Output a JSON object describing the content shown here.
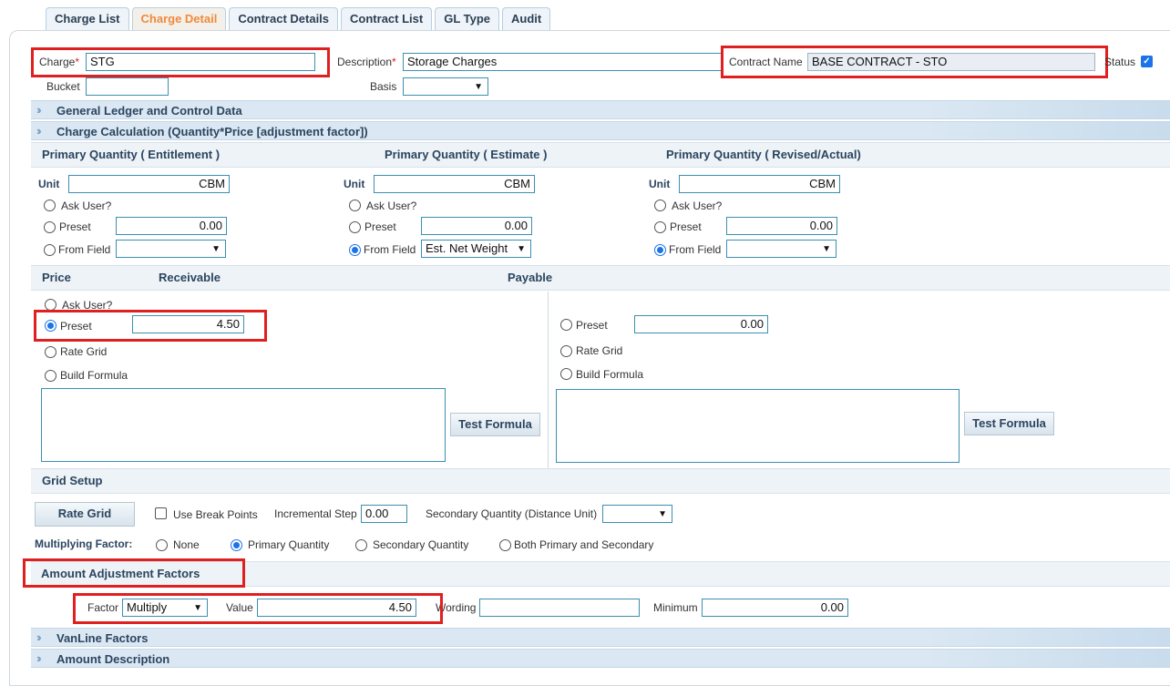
{
  "tabs": [
    "Charge List",
    "Charge Detail",
    "Contract Details",
    "Contract List",
    "GL Type",
    "Audit"
  ],
  "header": {
    "charge_label": "Charge",
    "charge_value": "STG",
    "description_label": "Description",
    "description_value": "Storage Charges",
    "contract_name_label": "Contract Name",
    "contract_name_value": "BASE CONTRACT - STO",
    "status_label": "Status",
    "bucket_label": "Bucket",
    "bucket_value": "",
    "basis_label": "Basis",
    "basis_value": "",
    "required_mark": "*"
  },
  "sections": {
    "gl": "General Ledger and Control Data",
    "calc": "Charge Calculation (Quantity*Price [adjustment factor])",
    "vanline": "VanLine Factors",
    "amount_desc": "Amount Description"
  },
  "quantities": [
    {
      "title": "Primary Quantity  ( Entitlement )",
      "unit_label": "Unit",
      "unit": "CBM",
      "ask": "Ask User?",
      "preset": "Preset",
      "preset_value": "0.00",
      "from_field": "From Field",
      "from_field_value": "",
      "selected": "none"
    },
    {
      "title": "Primary Quantity  ( Estimate )",
      "unit_label": "Unit",
      "unit": "CBM",
      "ask": "Ask User?",
      "preset": "Preset",
      "preset_value": "0.00",
      "from_field": "From Field",
      "from_field_value": "Est. Net Weight",
      "selected": "from_field"
    },
    {
      "title": "Primary Quantity  ( Revised/Actual)",
      "unit_label": "Unit",
      "unit": "CBM",
      "ask": "Ask User?",
      "preset": "Preset",
      "preset_value": "0.00",
      "from_field": "From Field",
      "from_field_value": "",
      "selected": "from_field"
    }
  ],
  "price": {
    "price_label": "Price",
    "receivable_label": "Receivable",
    "payable_label": "Payable",
    "receivable": {
      "ask": "Ask User?",
      "preset": "Preset",
      "preset_value": "4.50",
      "rate_grid": "Rate Grid",
      "build_formula": "Build Formula",
      "test_formula": "Test Formula",
      "selected": "preset"
    },
    "payable": {
      "preset": "Preset",
      "preset_value": "0.00",
      "rate_grid": "Rate Grid",
      "build_formula": "Build Formula",
      "test_formula": "Test Formula",
      "selected": "none"
    }
  },
  "grid_setup": {
    "title": "Grid Setup",
    "rate_grid_button": "Rate Grid",
    "use_break_points": "Use Break Points",
    "incremental_step_label": "Incremental Step",
    "incremental_step_value": "0.00",
    "secondary_quantity_label": "Secondary Quantity (Distance Unit)",
    "secondary_quantity_value": "",
    "multiplying_factor_label": "Multiplying Factor:",
    "options": [
      "None",
      "Primary Quantity",
      "Secondary Quantity",
      "Both Primary and Secondary"
    ],
    "selected_option": "Primary Quantity"
  },
  "adjustment": {
    "title": "Amount Adjustment Factors",
    "factor_label": "Factor",
    "factor_value": "Multiply",
    "value_label": "Value",
    "value": "4.50",
    "wording_label": "Wording",
    "wording_value": "",
    "minimum_label": "Minimum",
    "minimum_value": "0.00"
  },
  "colors": {
    "active_tab_text": "#ef8a3c",
    "highlight": "#e02020",
    "accent_blue": "#1a73e8"
  }
}
